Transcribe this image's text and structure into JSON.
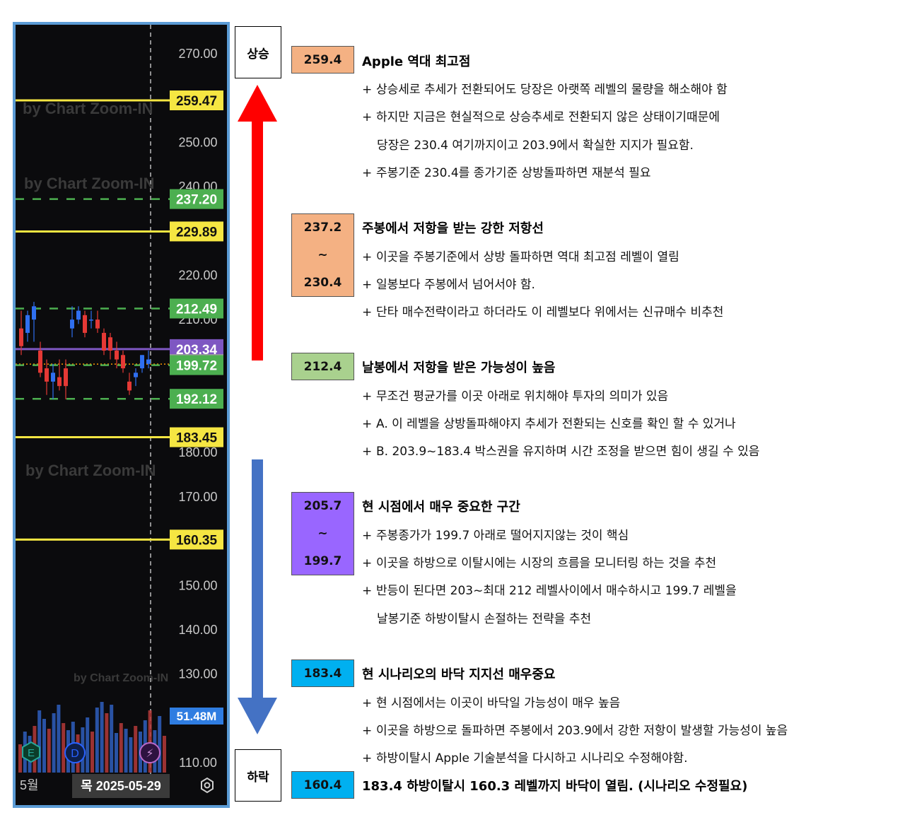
{
  "chart_data": {
    "type": "candlestick",
    "yaxis_ticks": [
      "270.00",
      "250.00",
      "240.00",
      "220.00",
      "210.00",
      "180.00",
      "170.00",
      "150.00",
      "140.00",
      "130.00",
      "110.00"
    ],
    "watermarks": [
      "by Chart Zoom-IN",
      "by Chart Zoom-IN",
      "by Chart Zoom-IN",
      "by Chart Zoom-IN"
    ],
    "horizontal_levels": [
      {
        "value": 259.47,
        "label": "259.47",
        "style": "solid",
        "color": "#f5e642"
      },
      {
        "value": 237.2,
        "label": "237.20",
        "style": "dashed",
        "color": "#4caf50"
      },
      {
        "value": 229.89,
        "label": "229.89",
        "style": "solid",
        "color": "#f5e642"
      },
      {
        "value": 212.49,
        "label": "212.49",
        "style": "dashed",
        "color": "#4caf50"
      },
      {
        "value": 203.34,
        "label": "203.34",
        "style": "solid",
        "color": "#7e57c2"
      },
      {
        "value": 199.95,
        "label": "199.95",
        "style": "dotted",
        "color": "#ff9800"
      },
      {
        "value": 199.72,
        "label": "199.72",
        "style": "dashed",
        "color": "#4caf50"
      },
      {
        "value": 192.12,
        "label": "192.12",
        "style": "dashed",
        "color": "#4caf50"
      },
      {
        "value": 183.45,
        "label": "183.45",
        "style": "solid",
        "color": "#f5e642"
      },
      {
        "value": 160.35,
        "label": "160.35",
        "style": "solid",
        "color": "#f5e642"
      }
    ],
    "candles": [
      {
        "o": 208,
        "h": 212,
        "c": 204,
        "l": 202
      },
      {
        "o": 207,
        "h": 212,
        "c": 211,
        "l": 205
      },
      {
        "o": 210,
        "h": 214,
        "c": 213,
        "l": 205
      },
      {
        "o": 203,
        "h": 205,
        "c": 198,
        "l": 197
      },
      {
        "o": 199,
        "h": 201,
        "c": 196,
        "l": 193
      },
      {
        "o": 196,
        "h": 200,
        "c": 198,
        "l": 192
      },
      {
        "o": 197,
        "h": 201,
        "c": 195,
        "l": 194
      },
      {
        "o": 199,
        "h": 201,
        "c": 195,
        "l": 192
      },
      {
        "o": 208,
        "h": 213,
        "c": 210,
        "l": 206
      },
      {
        "o": 210,
        "h": 213,
        "c": 212,
        "l": 209
      },
      {
        "o": 211,
        "h": 212,
        "c": 207,
        "l": 206
      },
      {
        "o": 210,
        "h": 212,
        "c": 210,
        "l": 208
      },
      {
        "o": 210,
        "h": 212,
        "c": 208,
        "l": 207
      },
      {
        "o": 207,
        "h": 208,
        "c": 203,
        "l": 202
      },
      {
        "o": 206,
        "h": 207,
        "c": 203,
        "l": 201
      },
      {
        "o": 203,
        "h": 205,
        "c": 201,
        "l": 199
      },
      {
        "o": 202,
        "h": 203,
        "c": 199,
        "l": 198
      },
      {
        "o": 196,
        "h": 198,
        "c": 194,
        "l": 193
      },
      {
        "o": 197,
        "h": 199,
        "c": 198,
        "l": 195
      },
      {
        "o": 199,
        "h": 202,
        "c": 202,
        "l": 198
      },
      {
        "o": 200,
        "h": 203,
        "c": 201,
        "l": 199
      }
    ],
    "volume_label": "51.48M",
    "x_label": "5월",
    "date_label": "목 2025-05-29",
    "event_markers": [
      "E",
      "D",
      "⚡"
    ]
  },
  "scenario": {
    "up_label": "상승",
    "down_label": "하락",
    "colors": {
      "up_arrow": "#ff0000",
      "down_arrow": "#4472c4"
    }
  },
  "sections": [
    {
      "level_lines": [
        "259.4"
      ],
      "color": "#f4b183",
      "heading": "Apple 역대 최고점",
      "bullets": [
        {
          "plus": "+",
          "text": "상승세로 추세가 전환되어도 당장은 아랫쪽 레벨의 물량을 해소해야 함"
        },
        {
          "plus": "+",
          "text": "하지만 지금은 현실적으로 상승추세로 전환되지 않은 상태이기때문에"
        },
        {
          "plus": "",
          "text": "당장은 230.4 여기까지이고 203.9에서 확실한 지지가 필요함."
        },
        {
          "plus": "+",
          "text": "주봉기준 230.4를 종가기준 상방돌파하면 재분석 필요"
        }
      ]
    },
    {
      "level_lines": [
        "237.2",
        "~",
        "230.4"
      ],
      "color": "#f4b183",
      "heading": "주봉에서 저항을 받는 강한 저항선",
      "bullets": [
        {
          "plus": "+",
          "text": "이곳을 주봉기준에서 상방 돌파하면 역대 최고점 레벨이 열림"
        },
        {
          "plus": "+",
          "text": "일봉보다 주봉에서 넘어서야 함."
        },
        {
          "plus": "+",
          "text": "단타 매수전략이라고 하더라도 이 레벨보다 위에서는 신규매수 비추천"
        }
      ]
    },
    {
      "level_lines": [
        "212.4"
      ],
      "color": "#a9d18e",
      "heading": "날봉에서 저항을 받은 가능성이 높음",
      "bullets": [
        {
          "plus": "+",
          "text": "무조건 평균가를 이곳 아래로 위치해야 투자의 의미가 있음"
        },
        {
          "plus": "+",
          "text": "A. 이 레벨을 상방돌파해야지 추세가 전환되는 신호를 확인 할 수 있거나"
        },
        {
          "plus": "+",
          "text": "B. 203.9~183.4 박스권을 유지하며 시간 조정을 받으면 힘이 생길 수 있음"
        }
      ]
    },
    {
      "level_lines": [
        "205.7",
        "~",
        "199.7"
      ],
      "color": "#9966ff",
      "heading": "현 시점에서 매우 중요한 구간",
      "bullets": [
        {
          "plus": "+",
          "text": "주봉종가가 199.7 아래로 떨어지지않는 것이 핵심"
        },
        {
          "plus": "+",
          "text": "이곳을 하방으로 이탈시에는 시장의 흐름을 모니터링 하는 것을 추천"
        },
        {
          "plus": "+",
          "text": "반등이 된다면 203~최대 212 레벨사이에서 매수하시고 199.7 레벨을"
        },
        {
          "plus": "",
          "text": "날봉기준 하방이탈시 손절하는 전략을 추천"
        }
      ]
    },
    {
      "level_lines": [
        "183.4"
      ],
      "color": "#00b0f0",
      "heading": "현 시나리오의 바닥 지지선 매우중요",
      "bullets": [
        {
          "plus": "+",
          "text": "현 시점에서는 이곳이 바닥일 가능성이 매우 높음"
        },
        {
          "plus": "+",
          "text": "이곳을 하방으로 돌파하면 주봉에서 203.9에서 강한 저항이 발생할 가능성이 높음"
        },
        {
          "plus": "+",
          "text": "하방이탈시 Apple 기술분석을 다시하고 시나리오 수정해야함."
        }
      ]
    },
    {
      "level_lines": [
        "160.4"
      ],
      "color": "#00b0f0",
      "heading": "183.4 하방이탈시 160.3 레벨까지 바닥이 열림. (시나리오 수정필요)",
      "bullets": []
    }
  ]
}
